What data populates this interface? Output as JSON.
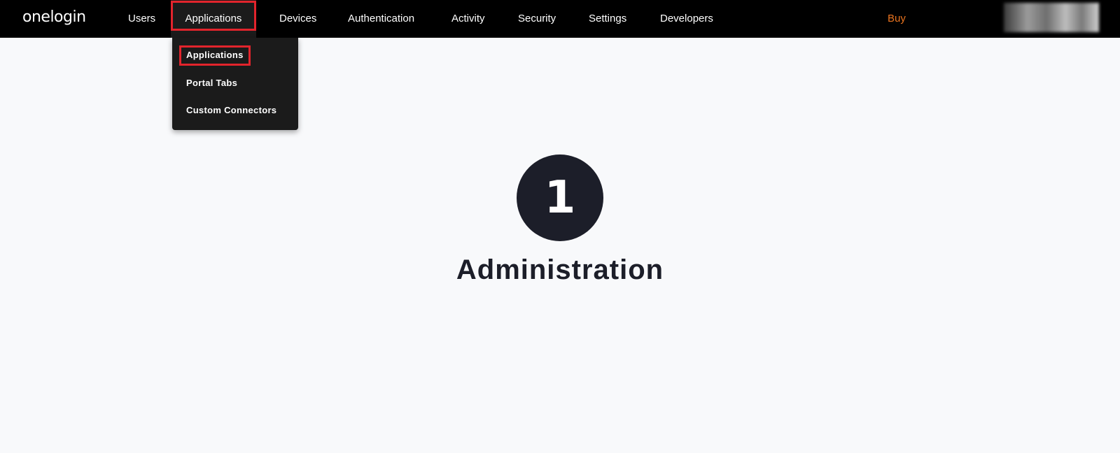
{
  "brand": {
    "logo_text": "onelogin"
  },
  "nav": {
    "items": [
      {
        "label": "Users"
      },
      {
        "label": "Applications",
        "active": true
      },
      {
        "label": "Devices"
      },
      {
        "label": "Authentication"
      },
      {
        "label": "Activity"
      },
      {
        "label": "Security"
      },
      {
        "label": "Settings"
      },
      {
        "label": "Developers"
      }
    ],
    "buy_label": "Buy",
    "buy_color": "#e9731f"
  },
  "dropdown": {
    "items": [
      {
        "label": "Applications",
        "highlighted": true
      },
      {
        "label": "Portal Tabs"
      },
      {
        "label": "Custom Connectors"
      }
    ]
  },
  "main": {
    "badge_number": "1",
    "heading": "Administration"
  },
  "colors": {
    "topbar": "#000000",
    "highlight": "#e2242c",
    "badge": "#1c1e29",
    "background": "#f8f9fb"
  }
}
